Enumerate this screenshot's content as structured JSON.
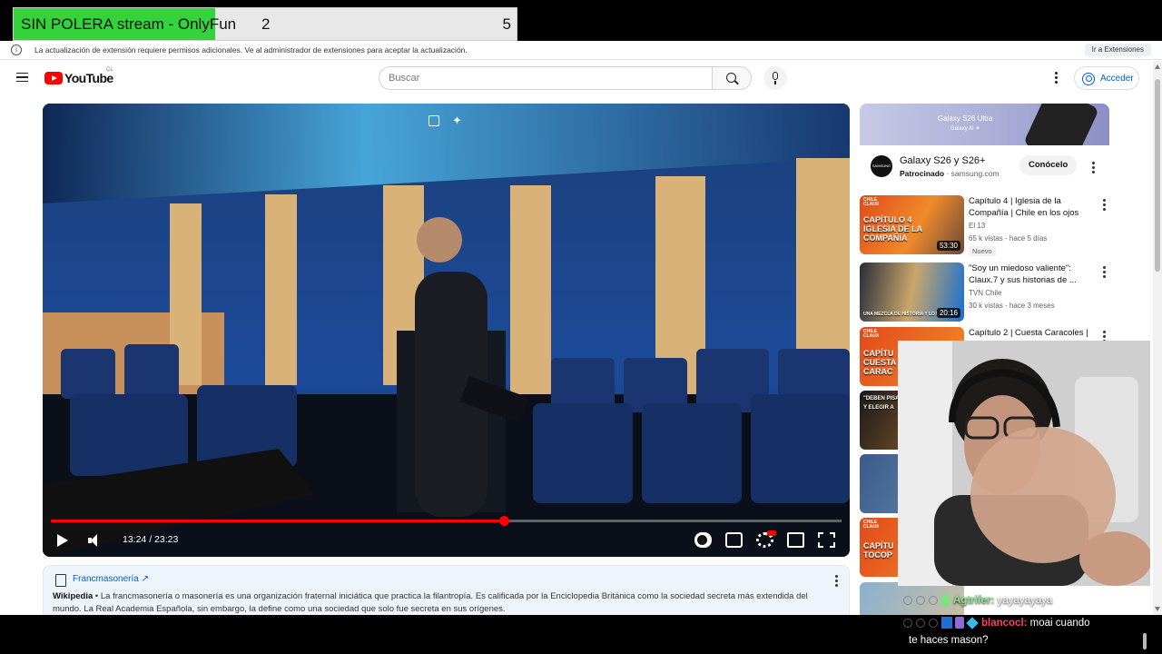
{
  "overlay": {
    "title": "SIN POLERA stream - OnlyFun",
    "count_current": "2",
    "count_goal": "5",
    "progress_fraction": 0.4
  },
  "infobar": {
    "message": "La actualización de extensión requiere permisos adicionales. Ve al administrador de extensiones para aceptar la actualización.",
    "button": "Ir a Extensiones"
  },
  "header": {
    "logo_text": "YouTube",
    "country_code": "CL",
    "search_placeholder": "Buscar",
    "signin_label": "Acceder"
  },
  "player": {
    "time": "13:24 / 23:23",
    "progress_fraction": 0.573
  },
  "info_panel": {
    "topic": "Francmasonería ↗",
    "source": "Wikipedia",
    "description": " • La francmasonería o masonería es una organización fraternal iniciática que practica la filantropía. Es calificada por la Enciclopedia Británica como la sociedad secreta más extendida del mundo. La Real Academia Española, sin embargo, la define como una sociedad que solo fue secreta en sus orígenes."
  },
  "ad": {
    "banner_text": "Galaxy S26 Ultra",
    "banner_sub": "Galaxy AI ✦",
    "brand": "SAMSUNG",
    "title": "Galaxy S26 y S26+",
    "sponsored": "Patrocinado",
    "domain": " · samsung.com",
    "cta": "Conócelo"
  },
  "recommendations": [
    {
      "title": "Capítulo 4 | Iglesia de la Compañía | Chile en los ojos de...",
      "channel": "El 13",
      "meta": "65 k vistas · hace 5 días",
      "badge": "Nuevo",
      "duration": "53:30",
      "thumb_label": "CAPÍTULO 4 IGLESIA DE LA COMPAÑÍA"
    },
    {
      "title": "\"Soy un miedoso valiente\": Claux.7 y sus historias de ...",
      "channel": "TVN Chile",
      "meta": "30 k vistas · hace 3 meses",
      "duration": "20:16",
      "thumb_label": "UNA MEZCLA DE HISTORIA Y LO PA"
    },
    {
      "title": "Capítulo 2 | Cuesta Caracoles |",
      "thumb_label": "CAPÍTU CUESTA CARAC"
    },
    {
      "thumb_label": "\"DEBEN PISA Y ELEGIR A"
    },
    {
      "thumb_label": ""
    },
    {
      "thumb_label": "CAPÍTU TOCOP"
    },
    {
      "thumb_label": ""
    }
  ],
  "chat": [
    {
      "user": "Agtrifer:",
      "message": " yayayayaya"
    },
    {
      "user": "blancocl:",
      "message": " moai cuando",
      "message_cont": "te haces mason?"
    }
  ]
}
